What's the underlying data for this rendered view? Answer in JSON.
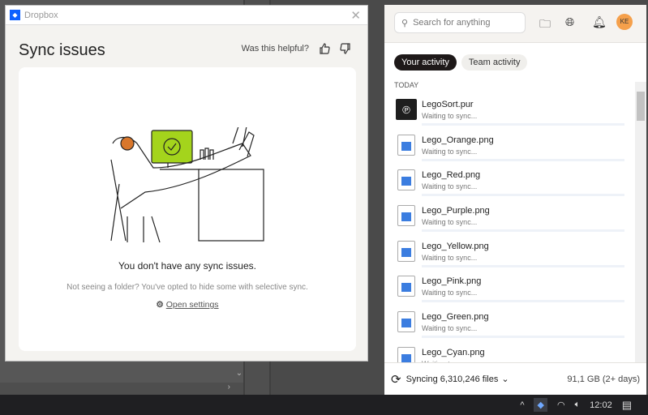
{
  "dialog": {
    "app_name": "Dropbox",
    "title": "Sync issues",
    "helpful_prompt": "Was this helpful?",
    "message": "You don't have any sync issues.",
    "hint": "Not seeing a folder? You've opted to hide some with selective sync.",
    "open_settings": "Open settings",
    "illustration_colors": {
      "screen": "#a4d41c"
    }
  },
  "panel": {
    "search_placeholder": "Search for anything",
    "avatar_initials": "KE",
    "avatar_color": "#f5a04b",
    "tabs": [
      {
        "label": "Your activity",
        "active": true
      },
      {
        "label": "Team activity",
        "active": false
      }
    ],
    "section": "TODAY",
    "files": [
      {
        "name": "LegoSort.pur",
        "status": "Waiting to sync...",
        "icon": "app-icon"
      },
      {
        "name": "Lego_Orange.png",
        "status": "Waiting to sync..."
      },
      {
        "name": "Lego_Red.png",
        "status": "Waiting to sync..."
      },
      {
        "name": "Lego_Purple.png",
        "status": "Waiting to sync..."
      },
      {
        "name": "Lego_Yellow.png",
        "status": "Waiting to sync..."
      },
      {
        "name": "Lego_Pink.png",
        "status": "Waiting to sync..."
      },
      {
        "name": "Lego_Green.png",
        "status": "Waiting to sync..."
      },
      {
        "name": "Lego_Cyan.png",
        "status": "Waiting to sync..."
      }
    ],
    "sync_status": "Syncing 6,310,246 files",
    "size_info": "91,1 GB (2+ days)"
  },
  "taskbar": {
    "time": "12:02"
  }
}
